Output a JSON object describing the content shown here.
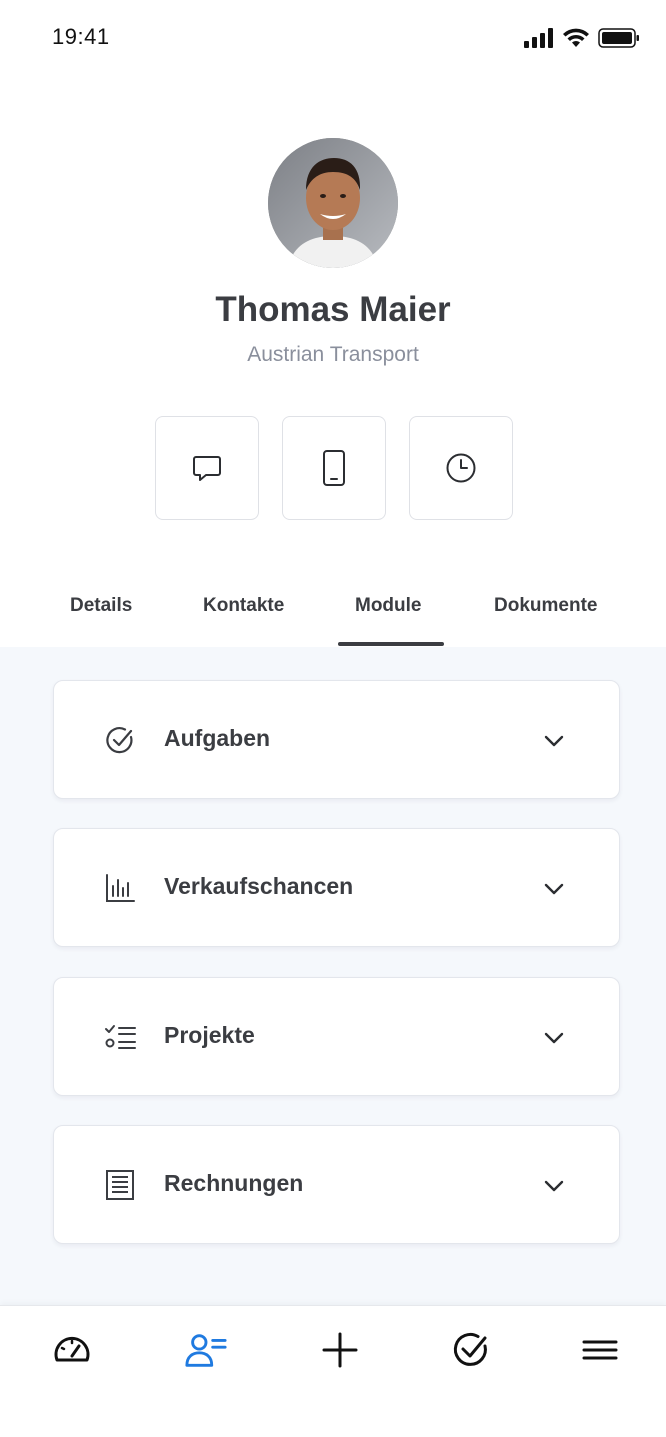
{
  "status_bar": {
    "time": "19:41",
    "icons": [
      "signal-icon",
      "wifi-icon",
      "battery-icon"
    ]
  },
  "profile": {
    "name": "Thomas Maier",
    "company": "Austrian Transport"
  },
  "actions": [
    {
      "name": "message-action",
      "icon": "chat-bubble-icon"
    },
    {
      "name": "phone-action",
      "icon": "mobile-phone-icon"
    },
    {
      "name": "history-action",
      "icon": "clock-icon"
    }
  ],
  "tabs": {
    "items": [
      {
        "label": "Details"
      },
      {
        "label": "Kontakte"
      },
      {
        "label": "Module"
      },
      {
        "label": "Dokumente"
      }
    ],
    "active": "Module"
  },
  "modules": [
    {
      "label": "Aufgaben",
      "icon": "task-check-icon"
    },
    {
      "label": "Verkaufschancen",
      "icon": "bar-chart-icon"
    },
    {
      "label": "Projekte",
      "icon": "checklist-icon"
    },
    {
      "label": "Rechnungen",
      "icon": "invoice-icon"
    }
  ],
  "bottom_nav": {
    "items": [
      {
        "name": "dashboard",
        "icon": "speedometer-icon"
      },
      {
        "name": "contacts",
        "icon": "contacts-icon",
        "active": true
      },
      {
        "name": "add",
        "icon": "plus-icon"
      },
      {
        "name": "tasks",
        "icon": "check-circle-icon"
      },
      {
        "name": "menu",
        "icon": "hamburger-menu-icon"
      }
    ],
    "active_color": "#1f7ae0"
  },
  "colors": {
    "text": "#3b3d42",
    "muted": "#8a8f9c",
    "background": "#f5f8fc",
    "accent": "#1f7ae0"
  }
}
